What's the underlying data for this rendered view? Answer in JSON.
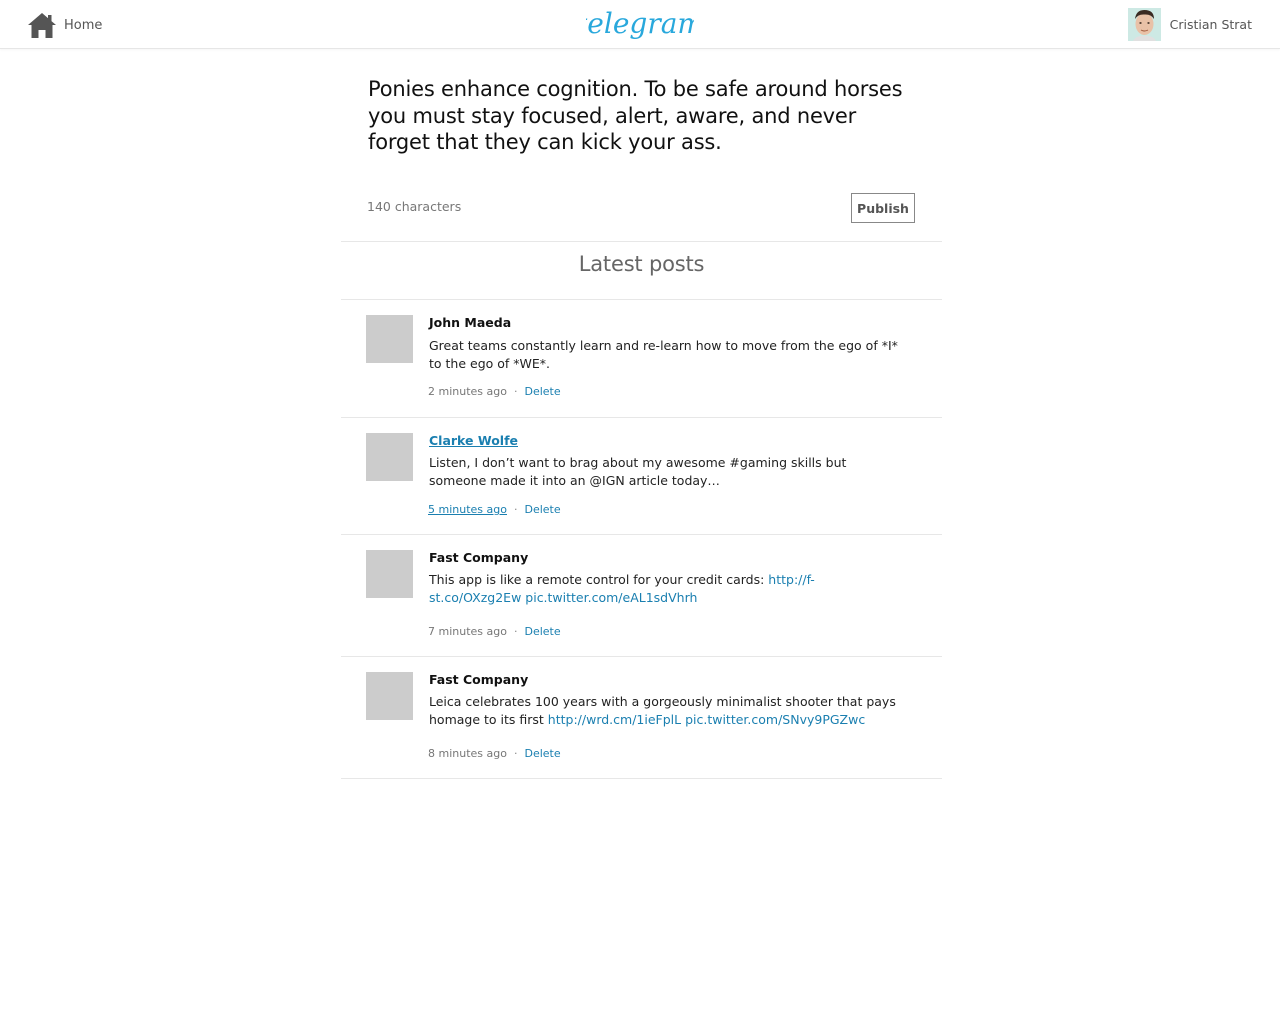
{
  "header": {
    "home_label": "Home",
    "logo_text": "telegram",
    "user_name": "Cristian Strat"
  },
  "composer": {
    "text": "Ponies enhance cognition. To be safe around horses you must stay focused, alert, aware, and never forget that they can kick your ass.",
    "char_count": "140 characters",
    "publish_label": "Publish"
  },
  "feed": {
    "title": "Latest posts",
    "delete_label": "Delete",
    "posts": [
      {
        "author": "John Maeda",
        "text": "Great teams constantly learn and re-learn how to move from the ego of *I* to the ego of *WE*.",
        "time": "2 minutes ago"
      },
      {
        "author": "Clarke Wolfe",
        "text": "Listen, I don’t want to brag about my awesome #gaming skills but someone made it into an @IGN article today…",
        "time": "5 minutes ago"
      },
      {
        "author": "Fast Company",
        "text": "This app is like a remote control for your credit cards: ",
        "link1": "http://f-st.co/OXzg2Ew",
        "link2": "pic.twitter.com/eAL1sdVhrh",
        "time": "7 minutes ago"
      },
      {
        "author": "Fast Company",
        "text": "Leica celebrates 100 years with a gorgeously minimalist shooter that pays homage to its first ",
        "link1": "http://wrd.cm/1ieFplL",
        "link2": "pic.twitter.com/SNvy9PGZwc",
        "time": "8 minutes ago"
      }
    ]
  },
  "colors": {
    "link": "#1a7fb0",
    "logo": "#29a8dc",
    "avatar_placeholder": "#cccccc",
    "divider": "#e7e7e7"
  },
  "icons": {
    "home": "home-icon",
    "user_avatar": "user-avatar-photo"
  }
}
